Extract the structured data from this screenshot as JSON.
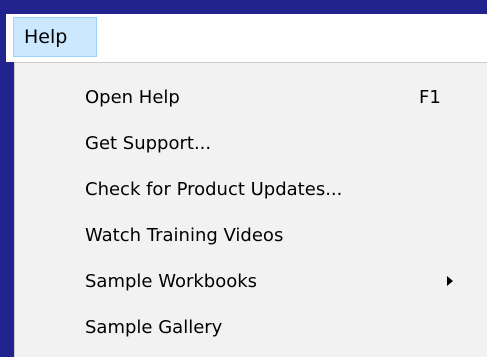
{
  "menubar": {
    "title": "Help"
  },
  "menu": {
    "items": [
      {
        "label": "Open Help",
        "shortcut": "F1"
      },
      {
        "label": "Get Support..."
      },
      {
        "label": "Check for Product Updates..."
      },
      {
        "label": "Watch Training Videos"
      },
      {
        "label": "Sample Workbooks",
        "submenu_icon": "chevron-right-icon"
      },
      {
        "label": "Sample Gallery"
      }
    ]
  },
  "colors": {
    "background": "#22238c",
    "menu_background": "#f2f2f2",
    "menubar_background": "#ffffff",
    "highlight": "#cce8ff",
    "highlight_border": "#99d1ff"
  }
}
